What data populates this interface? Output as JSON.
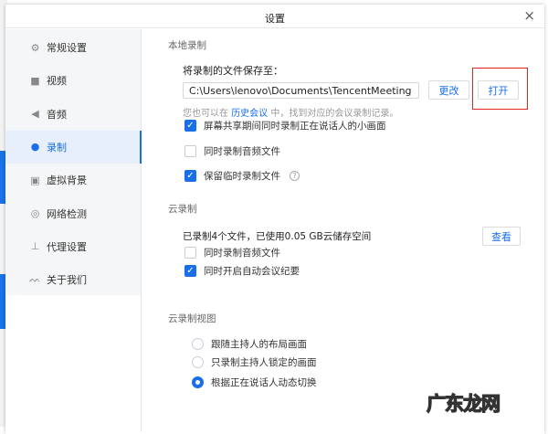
{
  "window": {
    "title": "设置",
    "close_icon": "×"
  },
  "sidebar": {
    "items": [
      {
        "label": "常规设置",
        "icon": "gear-icon",
        "glyph": "⚙"
      },
      {
        "label": "视频",
        "icon": "video-camera-icon",
        "glyph": "■"
      },
      {
        "label": "音频",
        "icon": "speaker-icon",
        "glyph": "◀"
      },
      {
        "label": "录制",
        "icon": "record-icon",
        "glyph": "●"
      },
      {
        "label": "虚拟背景",
        "icon": "portrait-icon",
        "glyph": "▣"
      },
      {
        "label": "网络检测",
        "icon": "globe-icon",
        "glyph": "◎"
      },
      {
        "label": "代理设置",
        "icon": "network-tree-icon",
        "glyph": "⊥"
      },
      {
        "label": "关于我们",
        "icon": "logo-icon",
        "glyph": "ᨓ"
      }
    ],
    "selected": "录制"
  },
  "local": {
    "heading": "本地录制",
    "save_label": "将录制的文件保存至：",
    "path": "C:\\Users\\lenovo\\Documents\\TencentMeeting",
    "change_button": "更改",
    "open_button": "打开",
    "hint_prefix": "您也可以在",
    "hint_link": "历史会议",
    "hint_suffix": "中，找到对应的会议录制记录。",
    "options": [
      {
        "label": "屏幕共享期间同时录制正在说话人的小画面",
        "checked": true
      },
      {
        "label": "同时录制音频文件",
        "checked": false
      },
      {
        "label": "保留临时录制文件",
        "checked": true
      }
    ],
    "help_icon": "?"
  },
  "cloud": {
    "heading": "云录制",
    "usage": "已录制4个文件，已使用0.05 GB云储存空间",
    "view_button": "查看",
    "options": [
      {
        "label": "同时录制音频文件",
        "checked": false
      },
      {
        "label": "同时开启自动会议纪要",
        "checked": true
      }
    ]
  },
  "cloud_view": {
    "heading": "云录制视图",
    "options": [
      {
        "label": "跟随主持人的布局画面",
        "selected": false
      },
      {
        "label": "只录制主持人锁定的画面",
        "selected": false
      },
      {
        "label": "根据正在说话人动态切换",
        "selected": true
      }
    ]
  },
  "watermark": "广东龙网",
  "colors": {
    "accent": "#1a6fe8",
    "highlight": "#e8211f"
  }
}
